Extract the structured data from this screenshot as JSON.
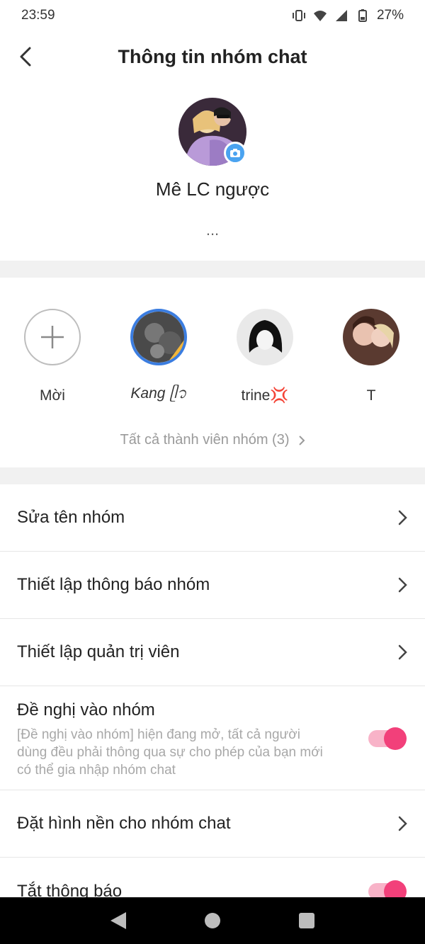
{
  "status": {
    "time": "23:59",
    "battery": "27%"
  },
  "header": {
    "title": "Thông tin nhóm chat"
  },
  "group": {
    "name": "Mê LC ngược",
    "description": "..."
  },
  "members": {
    "invite_label": "Mời",
    "list": [
      {
        "name": "Kang ᥫ᭡"
      },
      {
        "name": "trine💢"
      },
      {
        "name": "T"
      }
    ],
    "all_link": "Tất cả thành viên nhóm (3)"
  },
  "settings": {
    "rename": "Sửa tên nhóm",
    "notify_settings": "Thiết lập thông báo nhóm",
    "admin_settings": "Thiết lập quản trị viên",
    "join_request": {
      "title": "Đề nghị vào nhóm",
      "description": "[Đề nghị vào nhóm] hiện đang mở, tất cả người dùng đều phải thông qua sự cho phép của bạn mới có thể gia nhập nhóm chat",
      "enabled": true
    },
    "background": "Đặt hình nền cho nhóm chat",
    "mute": {
      "title": "Tắt thông báo",
      "enabled": true
    }
  },
  "colors": {
    "accent": "#f2407a",
    "accent_light": "#f8b3c8",
    "camera_badge": "#4aa3f0"
  }
}
